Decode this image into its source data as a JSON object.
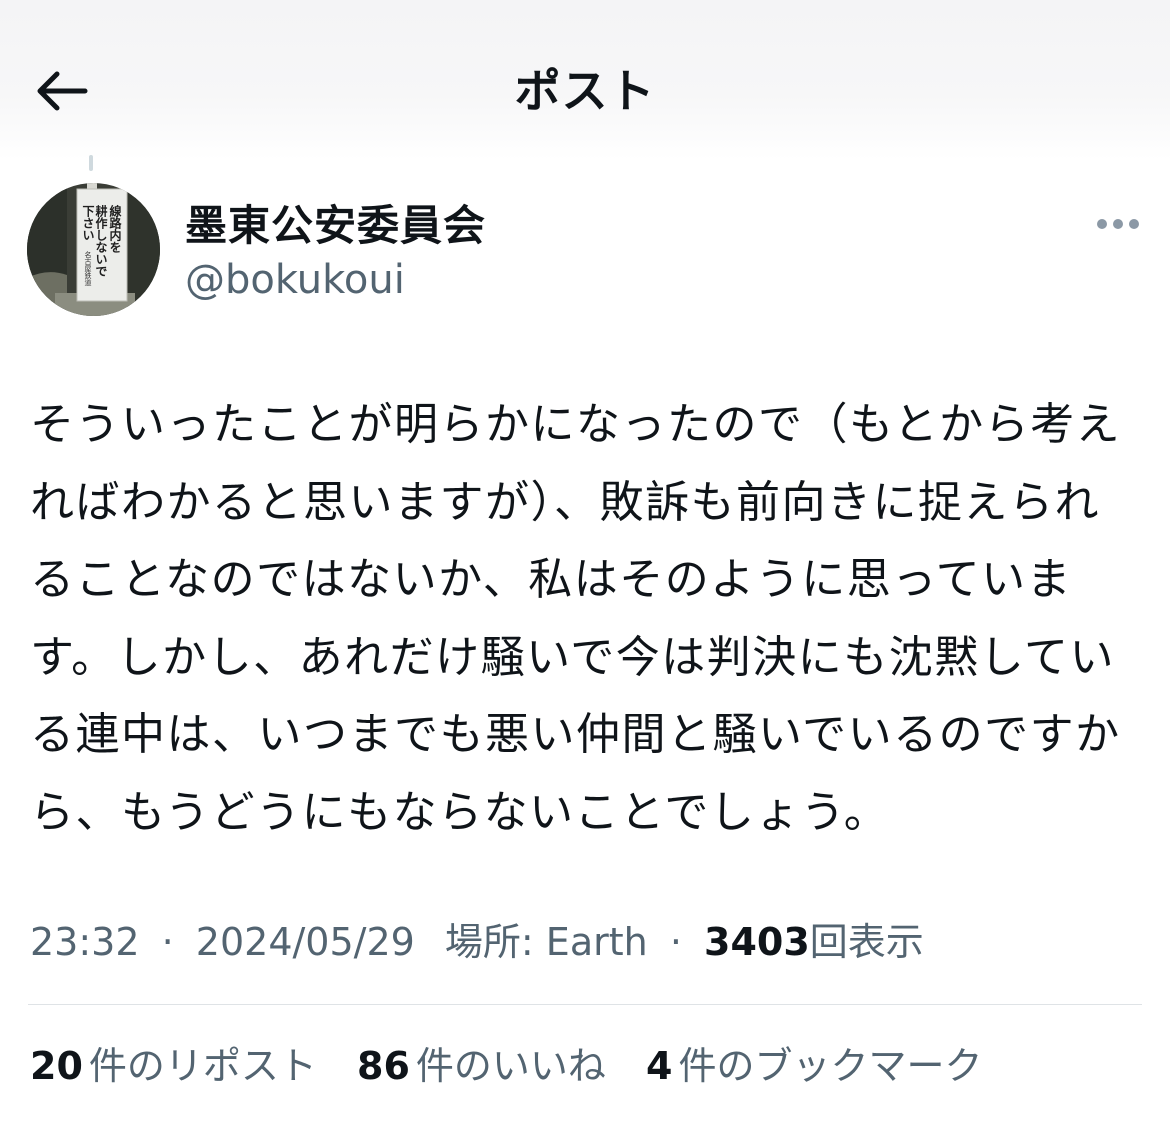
{
  "header": {
    "title": "ポスト",
    "back_icon": "back-arrow-icon"
  },
  "author": {
    "display_name": "墨東公安委員会",
    "handle": "@bokukoui",
    "avatar_sign_lines": [
      "線路内を",
      "耕作しないで",
      "下さい",
      "名古屋鉄道"
    ],
    "more_icon": "more-dots-icon"
  },
  "post": {
    "text": "そういったことが明らかになったので（もとから考えればわかると思いますが）、敗訴も前向きに捉えられることなのではないか、私はそのように思っています。しかし、あれだけ騒いで今は判決にも沈黙している連中は、いつまでも悪い仲間と騒いでいるのですから、もうどうにもならないことでしょう。"
  },
  "meta": {
    "time": "23:32",
    "separator": "·",
    "date": "2024/05/29",
    "location": "場所: Earth",
    "views_count": "3403",
    "views_label": "回表示"
  },
  "stats": {
    "reposts_count": "20",
    "reposts_label": "件のリポスト",
    "likes_count": "86",
    "likes_label": "件のいいね",
    "bookmarks_count": "4",
    "bookmarks_label": "件のブックマーク"
  },
  "colors": {
    "text_primary": "#0f1419",
    "text_secondary": "#536471",
    "divider": "#dfe3e6"
  }
}
